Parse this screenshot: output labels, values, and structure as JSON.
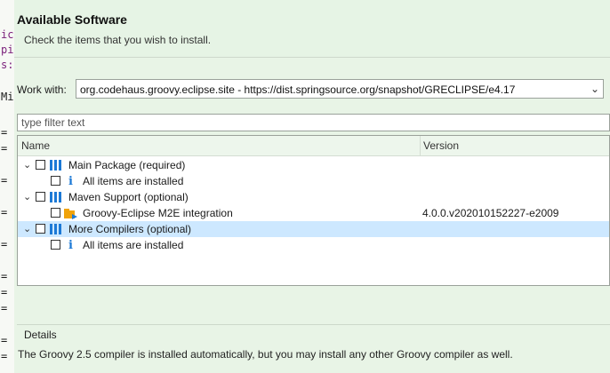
{
  "banner": {
    "title": "Available Software",
    "subtitle": "Check the items that you wish to install."
  },
  "work_with": {
    "label": "Work with:",
    "value": "org.codehaus.groovy.eclipse.site - https://dist.springsource.org/snapshot/GRECLIPSE/e4.17"
  },
  "filter": {
    "placeholder": "type filter text",
    "value": ""
  },
  "table": {
    "columns": [
      "Name",
      "Version"
    ],
    "rows": [
      {
        "level": 0,
        "type": "category",
        "label": "Main Package (required)",
        "version": "",
        "expanded": true,
        "checked": false,
        "selected": false
      },
      {
        "level": 1,
        "type": "info",
        "label": "All items are installed",
        "version": "",
        "checked": false,
        "selected": false
      },
      {
        "level": 0,
        "type": "category",
        "label": "Maven Support (optional)",
        "version": "",
        "expanded": true,
        "checked": false,
        "selected": false
      },
      {
        "level": 1,
        "type": "feature",
        "label": "Groovy-Eclipse M2E integration",
        "version": "4.0.0.v202010152227-e2009",
        "checked": false,
        "selected": false
      },
      {
        "level": 0,
        "type": "category",
        "label": "More Compilers (optional)",
        "version": "",
        "expanded": true,
        "checked": false,
        "selected": true
      },
      {
        "level": 1,
        "type": "info",
        "label": "All items are installed",
        "version": "",
        "checked": false,
        "selected": false
      }
    ]
  },
  "details": {
    "title": "Details",
    "text": "The Groovy 2.5 compiler is installed automatically, but you may install any other Groovy compiler as well."
  },
  "background_glyphs": [
    "ic",
    "pi",
    "s:",
    "Mi",
    "=",
    "=",
    "=",
    "=",
    "=",
    "=",
    "=",
    "=",
    "=",
    "="
  ],
  "colors": {
    "banner_bg": "#e6f4e5",
    "body_bg": "#e8f4e6",
    "selection": "#cde8ff",
    "icon_blue": "#1c79d6",
    "plugin_orange": "#f0a30a"
  }
}
